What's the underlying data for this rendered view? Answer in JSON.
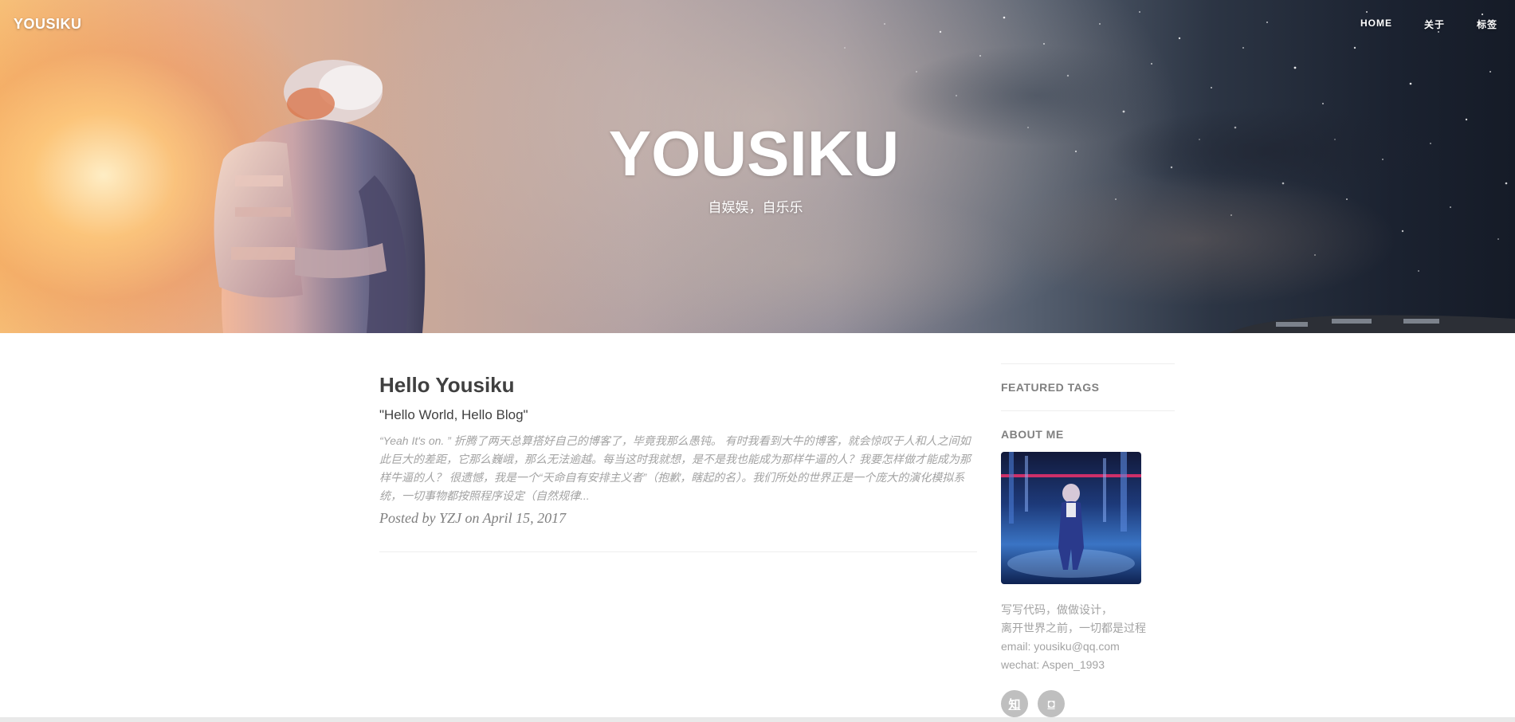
{
  "navbar": {
    "brand": "YOUSIKU",
    "links": [
      "HOME",
      "关于",
      "标签"
    ]
  },
  "hero": {
    "title": "YOUSIKU",
    "subtitle": "自娱娱，自乐乐"
  },
  "post": {
    "title": "Hello Yousiku",
    "subtitle": "\"Hello World, Hello Blog\"",
    "excerpt": "“Yeah It's on. ” 折腾了两天总算搭好自己的博客了，毕竟我那么愚钝。 有时我看到大牛的博客，就会惊叹于人和人之间如此巨大的差距，它那么巍峨，那么无法逾越。每当这时我就想，是不是我也能成为那样牛逼的人？我要怎样做才能成为那样牛逼的人？ 很遗憾，我是一个“天命自有安排主义者”（抱歉，瞎起的名）。我们所处的世界正是一个庞大的演化模拟系统，一切事物都按照程序设定（自然规律...",
    "meta": "Posted by YZJ on April 15, 2017"
  },
  "sidebar": {
    "featured_tags_heading": "FEATURED TAGS",
    "about_heading": "ABOUT ME",
    "about_lines": [
      "写写代码，做做设计，",
      "离开世界之前，一切都是过程",
      "email: yousiku@qq.com",
      "wechat: Aspen_1993"
    ],
    "social": [
      "知",
      "◘"
    ]
  },
  "colors": {
    "heading": "#404040",
    "muted": "#a3a3a3",
    "meta": "#808080"
  }
}
